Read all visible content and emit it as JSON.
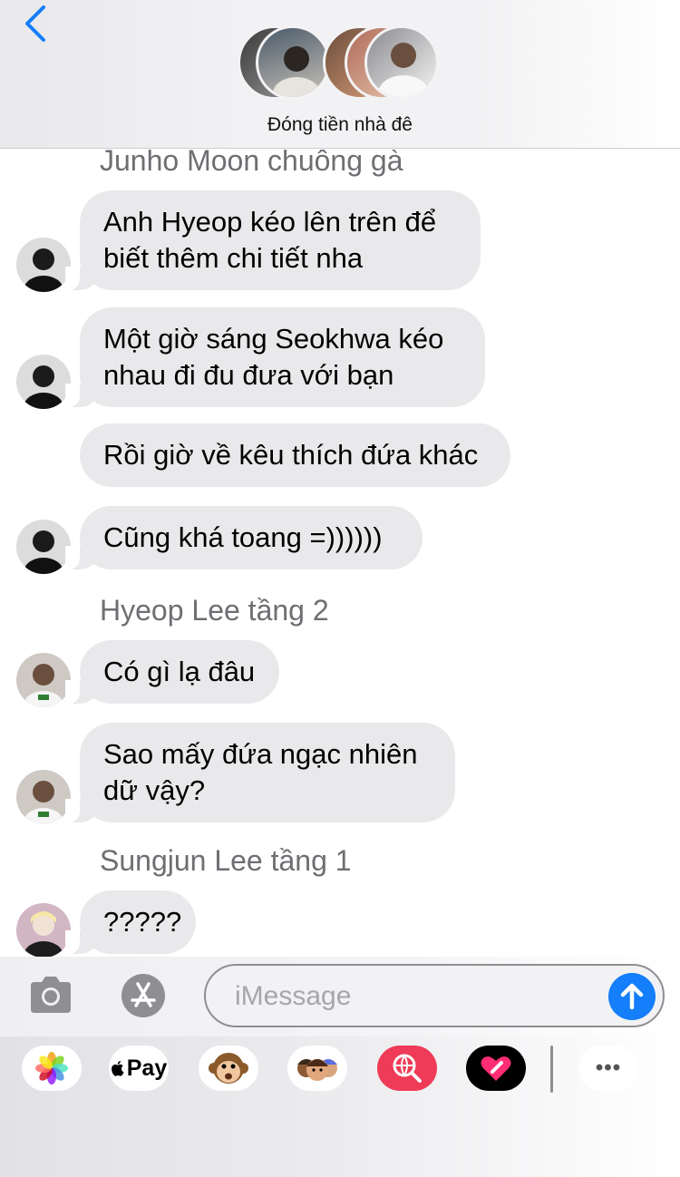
{
  "header": {
    "group_name": "Đóng tiền nhà đê"
  },
  "messages": [
    {
      "type": "sender",
      "text": "Junho Moon chuông gà"
    },
    {
      "type": "bubble",
      "text": "Anh Hyeop kéo lên trên để biết thêm chi tiết nha",
      "avatar": "junho"
    },
    {
      "type": "bubble",
      "text": "Một giờ sáng Seokhwa kéo nhau đi đu đưa với bạn",
      "avatar": "junho"
    },
    {
      "type": "bubble",
      "text": "Rồi giờ về kêu thích đứa khác",
      "avatar": null
    },
    {
      "type": "bubble",
      "text": "Cũng khá toang =))))))",
      "avatar": "junho"
    },
    {
      "type": "sender",
      "text": "Hyeop Lee tầng 2"
    },
    {
      "type": "bubble",
      "text": "Có gì lạ đâu",
      "avatar": "hyeop"
    },
    {
      "type": "bubble",
      "text": "Sao mấy đứa ngạc nhiên dữ vậy?",
      "avatar": "hyeop"
    },
    {
      "type": "sender",
      "text": "Sungjun Lee tầng 1"
    },
    {
      "type": "bubble",
      "text": "?????",
      "avatar": "sungjun"
    }
  ],
  "input": {
    "placeholder": "iMessage"
  },
  "apps": {
    "applepay_label": "Pay",
    "more_label": "•••"
  },
  "colors": {
    "accent": "#147efb",
    "bubble": "#e9e9eb",
    "sender_text": "#6e6e73"
  }
}
